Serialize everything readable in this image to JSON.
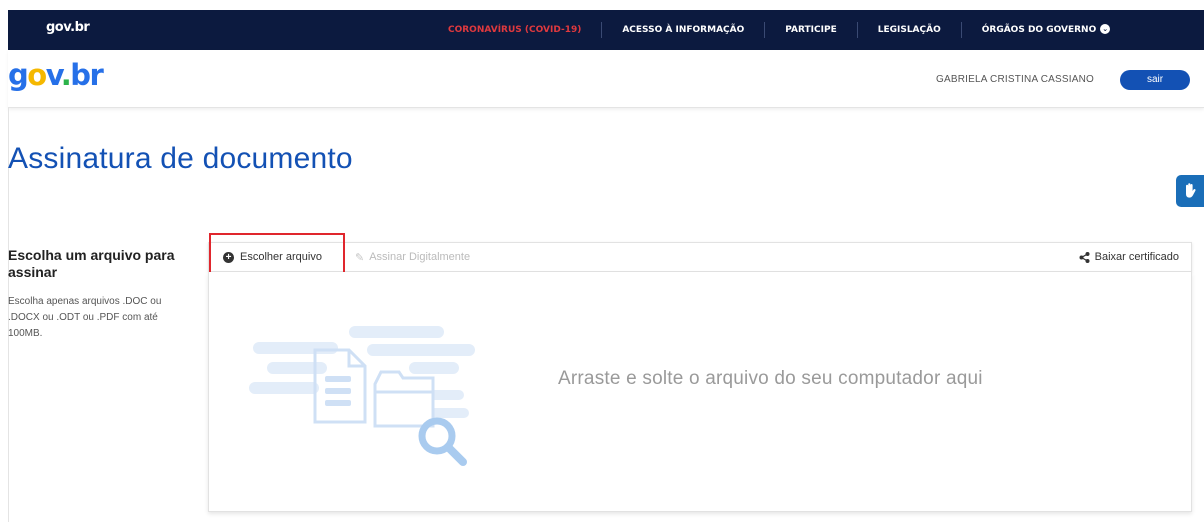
{
  "topbar": {
    "brand": "gov.br",
    "links": [
      {
        "label": "CORONAVÍRUS (COVID-19)",
        "highlight": true
      },
      {
        "label": "ACESSO À INFORMAÇÃO"
      },
      {
        "label": "PARTICIPE"
      },
      {
        "label": "LEGISLAÇÃO"
      },
      {
        "label": "ÓRGÃOS DO GOVERNO"
      }
    ],
    "chevron": "⌄"
  },
  "header": {
    "logo": {
      "g": "g",
      "o1": "o",
      "v": "v",
      "dot": ".",
      "br": "br"
    },
    "username": "GABRIELA CRISTINA CASSIANO",
    "logout_label": "sair"
  },
  "page": {
    "title": "Assinatura de documento",
    "accessibility_icon": "hand-icon"
  },
  "sidebar": {
    "title": "Escolha um arquivo para assinar",
    "description": "Escolha apenas arquivos .DOC ou .DOCX ou .ODT ou .PDF com até 100MB."
  },
  "toolbar": {
    "choose_label": "Escolher arquivo",
    "sign_label": "Assinar Digitalmente",
    "certificate_label": "Baixar certificado"
  },
  "dropzone": {
    "text": "Arraste e solte o arquivo do seu computador aqui"
  },
  "colors": {
    "topbar_bg": "#0c1a3f",
    "primary": "#1351b4",
    "covid": "#e0393e",
    "highlight_border": "#e0262d",
    "illustration": "#cfe2f7"
  }
}
